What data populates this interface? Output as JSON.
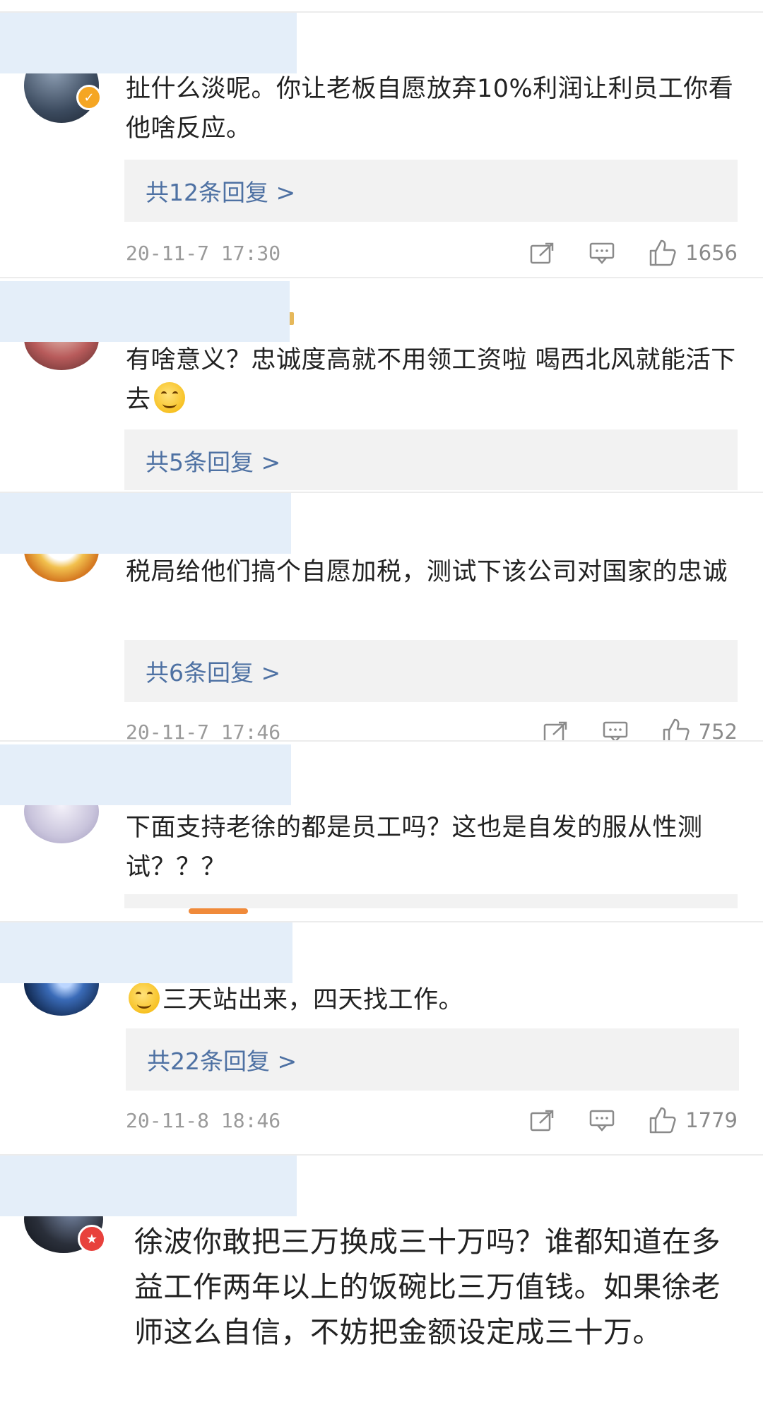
{
  "comments": [
    {
      "text": "扯什么淡呢。你让老板自愿放弃10%利润让利员工你看他啥反应。",
      "reply": "共12条回复 >",
      "time": "20-11-7 17:30",
      "likes": "1656",
      "avatar_color": "#3b4a5e",
      "badge": "✓"
    },
    {
      "text": "有啥意义？忠诚度高就不用领工资啦 喝西北风就能活下去",
      "reply": "共5条回复 >",
      "avatar_color": "#7a3a3a"
    },
    {
      "text": "税局给他们搞个自愿加税，测试下该公司对国家的忠诚",
      "reply": "共6条回复 >",
      "time": "20-11-7 17:46",
      "likes": "752",
      "avatar_color": "#e8a23a"
    },
    {
      "text": "下面支持老徐的都是员工吗？这也是自发的服从性测试？？？",
      "avatar_color": "#c9c4dc"
    },
    {
      "text": "三天站出来，四天找工作。",
      "reply": "共22条回复 >",
      "time": "20-11-8 18:46",
      "likes": "1779",
      "avatar_color": "#1f3a6a"
    },
    {
      "text": "徐波你敢把三万换成三十万吗？谁都知道在多益工作两年以上的饭碗比三万值钱。如果徐老师这么自信，不妨把金额设定成三十万。",
      "avatar_color": "#2a2f3a",
      "badge": "★"
    }
  ],
  "icons": {
    "share": "share-icon",
    "comment": "comment-icon",
    "like": "like-icon"
  },
  "colors": {
    "reply_link": "#4e71a3",
    "reply_bg": "#f2f2f2",
    "mask": "#e4eef9",
    "badge_gold": "#f5a623",
    "badge_red": "#e8413c"
  }
}
